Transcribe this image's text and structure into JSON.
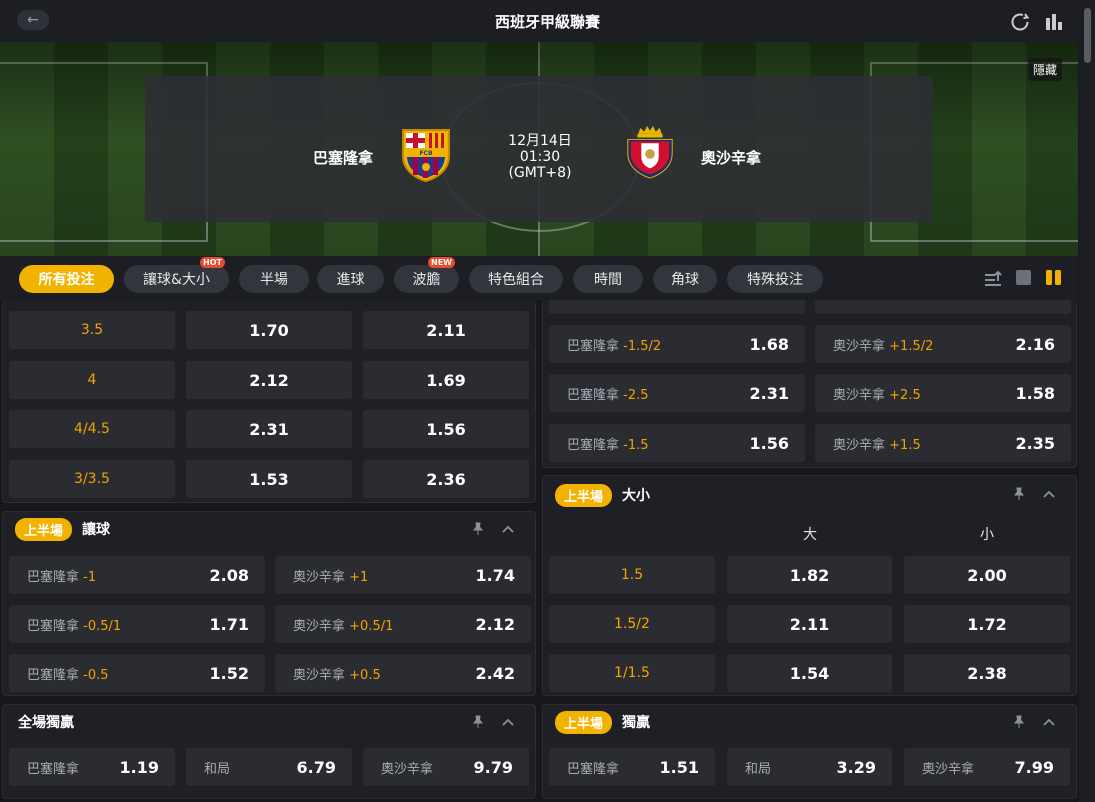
{
  "header": {
    "title": "西班牙甲級聯賽",
    "back_icon": "arrow-left-icon",
    "refresh_icon": "refresh-icon",
    "stats_icon": "bar-chart-icon"
  },
  "banner": {
    "hide_label": "隱藏"
  },
  "match": {
    "home": "巴塞隆拿",
    "away": "奧沙辛拿",
    "date": "12月14日",
    "time": "01:30",
    "timezone": "(GMT+8)",
    "home_crest_text": "FCB"
  },
  "tabs": [
    {
      "label": "所有投注",
      "active": true
    },
    {
      "label": "讓球&大小",
      "badge": "HOT"
    },
    {
      "label": "半場"
    },
    {
      "label": "進球"
    },
    {
      "label": "波膽",
      "badge": "NEW"
    },
    {
      "label": "特色組合"
    },
    {
      "label": "時間"
    },
    {
      "label": "角球"
    },
    {
      "label": "特殊投注"
    }
  ],
  "colors": {
    "accent": "#f2b200",
    "line": "#f2a400",
    "cell": "#2a2c32"
  },
  "left_ou_rows": [
    {
      "line": "3.5",
      "over": "1.70",
      "under": "2.11"
    },
    {
      "line": "4",
      "over": "2.12",
      "under": "1.69"
    },
    {
      "line": "4/4.5",
      "over": "2.31",
      "under": "1.56"
    },
    {
      "line": "3/3.5",
      "over": "1.53",
      "under": "2.36"
    }
  ],
  "right_hc_rows": [
    {
      "home": "巴塞隆拿",
      "home_line": "-1.5/2",
      "home_odds": "1.68",
      "away": "奧沙辛拿",
      "away_line": "+1.5/2",
      "away_odds": "2.16"
    },
    {
      "home": "巴塞隆拿",
      "home_line": "-2.5",
      "home_odds": "2.31",
      "away": "奧沙辛拿",
      "away_line": "+2.5",
      "away_odds": "1.58"
    },
    {
      "home": "巴塞隆拿",
      "home_line": "-1.5",
      "home_odds": "1.56",
      "away": "奧沙辛拿",
      "away_line": "+1.5",
      "away_odds": "2.35"
    }
  ],
  "fh_handicap": {
    "pill": "上半場",
    "title": "讓球",
    "rows": [
      {
        "home": "巴塞隆拿",
        "home_line": "-1",
        "home_odds": "2.08",
        "away": "奧沙辛拿",
        "away_line": "+1",
        "away_odds": "1.74"
      },
      {
        "home": "巴塞隆拿",
        "home_line": "-0.5/1",
        "home_odds": "1.71",
        "away": "奧沙辛拿",
        "away_line": "+0.5/1",
        "away_odds": "2.12"
      },
      {
        "home": "巴塞隆拿",
        "home_line": "-0.5",
        "home_odds": "1.52",
        "away": "奧沙辛拿",
        "away_line": "+0.5",
        "away_odds": "2.42"
      }
    ]
  },
  "fh_ou": {
    "pill": "上半場",
    "title": "大小",
    "over_label": "大",
    "under_label": "小",
    "rows": [
      {
        "line": "1.5",
        "over": "1.82",
        "under": "2.00"
      },
      {
        "line": "1.5/2",
        "over": "2.11",
        "under": "1.72"
      },
      {
        "line": "1/1.5",
        "over": "1.54",
        "under": "2.38"
      }
    ]
  },
  "ft_1x2": {
    "title": "全場獨贏",
    "home": "巴塞隆拿",
    "home_odds": "1.19",
    "draw": "和局",
    "draw_odds": "6.79",
    "away": "奧沙辛拿",
    "away_odds": "9.79"
  },
  "fh_1x2": {
    "pill": "上半場",
    "title": "獨贏",
    "home": "巴塞隆拿",
    "home_odds": "1.51",
    "draw": "和局",
    "draw_odds": "3.29",
    "away": "奧沙辛拿",
    "away_odds": "7.99"
  }
}
